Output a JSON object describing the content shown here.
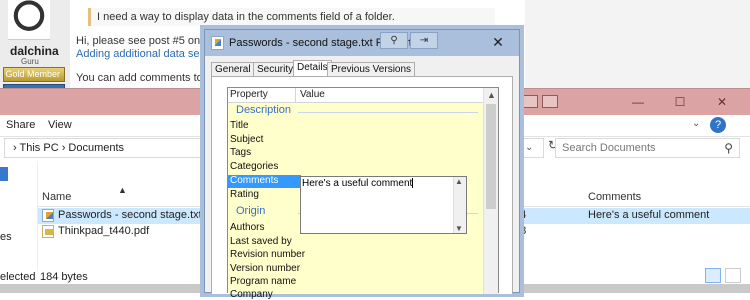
{
  "forum": {
    "username": "dalchina",
    "user_title": "Guru",
    "rank_badge": "Gold Member",
    "quote": "I need a way to display data in the comments field of a folder.",
    "line1": "Hi, please see post #5 onwards",
    "link": "Adding additional data seen by",
    "line2": "You can add comments to a fol"
  },
  "explorer": {
    "ribbon_tabs": [
      "Share",
      "View"
    ],
    "window_controls": {
      "minimize": "—",
      "maximize": "☐",
      "close": "✕"
    },
    "address": {
      "path": "›  This PC  ›  Documents"
    },
    "search": {
      "placeholder": "Search Documents"
    },
    "columns": {
      "name": "Name",
      "comments": "Comments"
    },
    "files": [
      {
        "name": "Passwords - second stage.txt",
        "size": "34",
        "comment": "Here's a useful comment"
      },
      {
        "name": "Thinkpad_t440.pdf",
        "size": "18",
        "comment": ""
      }
    ],
    "nav_fragment": "es",
    "status": {
      "selected": "elected",
      "size": "184 bytes"
    }
  },
  "dialog": {
    "title": "Passwords - second stage.txt Properties",
    "tabs": [
      "General",
      "Security",
      "Details",
      "Previous Versions"
    ],
    "active_tab": "Details",
    "headers": {
      "property": "Property",
      "value": "Value"
    },
    "sections": {
      "description": "Description",
      "origin": "Origin"
    },
    "description_props": [
      "Title",
      "Subject",
      "Tags",
      "Categories",
      "Comments",
      "Rating"
    ],
    "origin_props": [
      "Authors",
      "Last saved by",
      "Revision number",
      "Version number",
      "Program name",
      "Company"
    ],
    "comment_value": "Here's a useful comment",
    "close": "✕"
  },
  "colors": {
    "explorer_title": "#dba3a3",
    "dialog_title": "#a9bfdc",
    "selection": "#3399ff",
    "value_panel": "#ffffcc"
  }
}
